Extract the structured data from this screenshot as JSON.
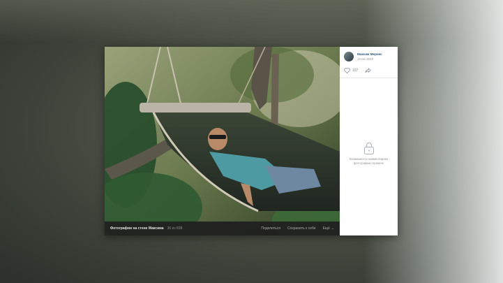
{
  "footer": {
    "title": "Фотографии на стене Максима",
    "count": "36 из 838",
    "share": "Поделиться",
    "save": "Сохранить к себе",
    "more": "Ещё"
  },
  "author": {
    "name": "Максим Мернес",
    "date": "13 сен 2020"
  },
  "likes": {
    "count": "107"
  },
  "comments": {
    "locked_text": "Возможность комментирова\nфотографии ограниче"
  },
  "colors": {
    "link": "#2a5885",
    "muted": "#939393",
    "footer_bg": "#1e1e1e"
  },
  "icons": [
    "heart-icon",
    "share-icon",
    "lock-icon",
    "chevron-down-icon"
  ]
}
